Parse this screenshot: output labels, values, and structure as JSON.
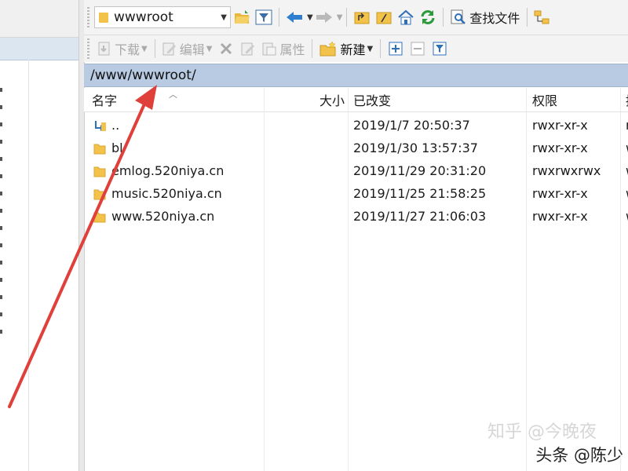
{
  "location_combo": {
    "value": "wwwroot"
  },
  "toolbar_top": {
    "find_files_label": "查找文件"
  },
  "toolbar_bottom": {
    "download_label": "下载",
    "edit_label": "编辑",
    "properties_label": "属性",
    "new_label": "新建"
  },
  "path": "/www/wwwroot/",
  "columns": {
    "name": "名字",
    "size": "大小",
    "modified": "已改变",
    "permissions": "权限",
    "owner": "拥"
  },
  "files": [
    {
      "name": "..",
      "modified": "2019/1/7 20:50:37",
      "permissions": "rwxr-xr-x",
      "owner": "r",
      "icon": "parent-folder-icon"
    },
    {
      "name": "bl",
      "modified": "2019/1/30 13:57:37",
      "permissions": "rwxr-xr-x",
      "owner": "w",
      "icon": "folder-icon"
    },
    {
      "name": "emlog.520niya.cn",
      "modified": "2019/11/29 20:31:20",
      "permissions": "rwxrwxrwx",
      "owner": "w",
      "icon": "folder-icon"
    },
    {
      "name": "music.520niya.cn",
      "modified": "2019/11/25 21:58:25",
      "permissions": "rwxr-xr-x",
      "owner": "w",
      "icon": "folder-icon"
    },
    {
      "name": "www.520niya.cn",
      "modified": "2019/11/27 21:06:03",
      "permissions": "rwxr-xr-x",
      "owner": "w",
      "icon": "folder-icon"
    }
  ],
  "watermark": {
    "zhihu": "知乎 @今晚夜",
    "toutiao": "头条 @陈少"
  },
  "colors": {
    "path_bar": "#b8cbe3",
    "folder": "#f2c24b",
    "annotation_arrow": "#e0403a"
  }
}
